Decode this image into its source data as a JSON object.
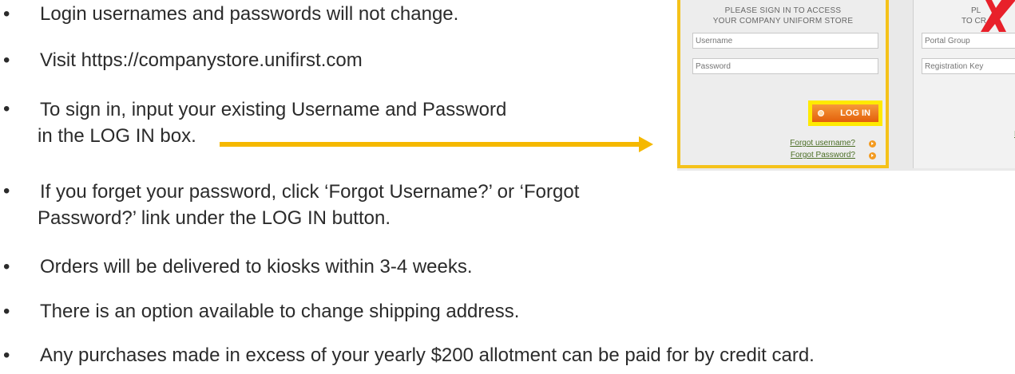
{
  "bullets": {
    "symbol": "•",
    "items": [
      {
        "lines": [
          "Login usernames and passwords will not change."
        ]
      },
      {
        "lines": [
          "Visit  https://companystore.unifirst.com"
        ]
      },
      {
        "lines": [
          "To sign in, input your existing Username and Password",
          "in the LOG IN box."
        ]
      },
      {
        "lines": [
          "If you forget your password, click ‘Forgot Username?’ or ‘Forgot",
          "Password?’ link under the LOG IN button."
        ]
      },
      {
        "lines": [
          "Orders will be delivered to kiosks within 3-4 weeks."
        ]
      },
      {
        "lines": [
          "There is an option available to change shipping address."
        ]
      },
      {
        "lines": [
          "Any purchases made in excess of your yearly $200 allotment can be paid for by credit card."
        ]
      }
    ]
  },
  "screenshot": {
    "login": {
      "heading_line1": "PLEASE SIGN IN TO ACCESS",
      "heading_line2": "YOUR COMPANY UNIFORM STORE",
      "username_placeholder": "Username",
      "password_placeholder": "Password",
      "login_label": "LOG IN",
      "forgot_username": "Forgot username?",
      "forgot_password": "Forgot Password?"
    },
    "register": {
      "heading_line1": "PL",
      "heading_line2": "TO CR",
      "portal_group_placeholder": "Portal Group",
      "registration_key_placeholder": "Registration Key",
      "link_partial": "Ne"
    }
  },
  "colors": {
    "highlight_yellow": "#f5b800",
    "button_orange": "#e35f0b",
    "link_green": "#4b6e26",
    "red_mark": "#e8202a"
  }
}
